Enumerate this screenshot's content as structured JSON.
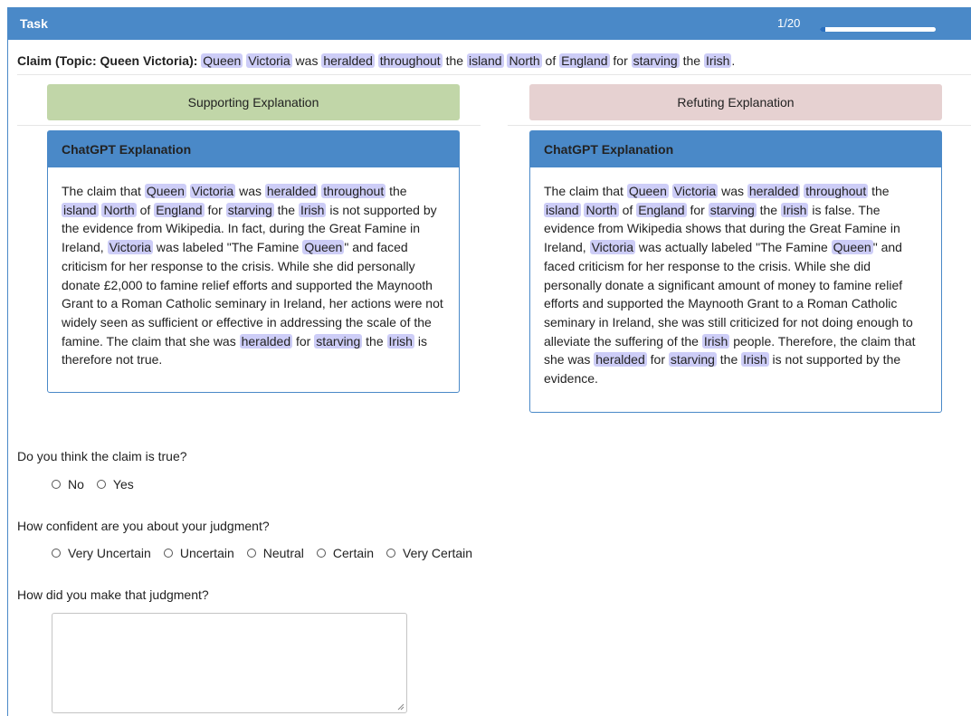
{
  "header": {
    "title": "Task",
    "progress_text": "1/20",
    "progress_fraction": 0.05,
    "color": "#4a89c8"
  },
  "claim": {
    "label": "Claim (Topic: Queen Victoria):",
    "segments": [
      {
        "t": "Queen",
        "hl": true
      },
      {
        "t": " "
      },
      {
        "t": "Victoria",
        "hl": true
      },
      {
        "t": " was "
      },
      {
        "t": "heralded",
        "hl": true
      },
      {
        "t": " "
      },
      {
        "t": "throughout",
        "hl": true
      },
      {
        "t": " the "
      },
      {
        "t": "island",
        "hl": true
      },
      {
        "t": " "
      },
      {
        "t": "North",
        "hl": true
      },
      {
        "t": " of "
      },
      {
        "t": "England",
        "hl": true
      },
      {
        "t": " for "
      },
      {
        "t": "starving",
        "hl": true
      },
      {
        "t": " the "
      },
      {
        "t": "Irish",
        "hl": true
      },
      {
        "t": "."
      }
    ]
  },
  "panes": {
    "supporting_label": "Supporting Explanation",
    "refuting_label": "Refuting Explanation",
    "supporting_color": "#c1d6a8",
    "refuting_color": "#e6d1d1"
  },
  "cards": {
    "left": {
      "title": "ChatGPT Explanation",
      "segments": [
        {
          "t": "The claim that "
        },
        {
          "t": "Queen",
          "hl": true
        },
        {
          "t": " "
        },
        {
          "t": "Victoria",
          "hl": true
        },
        {
          "t": " was "
        },
        {
          "t": "heralded",
          "hl": true
        },
        {
          "t": " "
        },
        {
          "t": "throughout",
          "hl": true
        },
        {
          "t": " the "
        },
        {
          "t": "island",
          "hl": true
        },
        {
          "t": " "
        },
        {
          "t": "North",
          "hl": true
        },
        {
          "t": " of "
        },
        {
          "t": "England",
          "hl": true
        },
        {
          "t": " for "
        },
        {
          "t": "starving",
          "hl": true
        },
        {
          "t": " the "
        },
        {
          "t": "Irish",
          "hl": true
        },
        {
          "t": " is not supported by the evidence from Wikipedia. In fact, during the Great Famine in Ireland, "
        },
        {
          "t": "Victoria",
          "hl": true
        },
        {
          "t": " was labeled \"The Famine "
        },
        {
          "t": "Queen",
          "hl": true
        },
        {
          "t": "\" and faced criticism for her response to the crisis. While she did personally donate £2,000 to famine relief efforts and supported the Maynooth Grant to a Roman Catholic seminary in Ireland, her actions were not widely seen as sufficient or effective in addressing the scale of the famine. The claim that she was "
        },
        {
          "t": "heralded",
          "hl": true
        },
        {
          "t": " for "
        },
        {
          "t": "starving",
          "hl": true
        },
        {
          "t": " the "
        },
        {
          "t": "Irish",
          "hl": true
        },
        {
          "t": " is therefore not true."
        }
      ]
    },
    "right": {
      "title": "ChatGPT Explanation",
      "segments": [
        {
          "t": "The claim that "
        },
        {
          "t": "Queen",
          "hl": true
        },
        {
          "t": " "
        },
        {
          "t": "Victoria",
          "hl": true
        },
        {
          "t": " was "
        },
        {
          "t": "heralded",
          "hl": true
        },
        {
          "t": " "
        },
        {
          "t": "throughout",
          "hl": true
        },
        {
          "t": " the "
        },
        {
          "t": "island",
          "hl": true
        },
        {
          "t": " "
        },
        {
          "t": "North",
          "hl": true
        },
        {
          "t": " of "
        },
        {
          "t": "England",
          "hl": true
        },
        {
          "t": " for "
        },
        {
          "t": "starving",
          "hl": true
        },
        {
          "t": " the "
        },
        {
          "t": "Irish",
          "hl": true
        },
        {
          "t": " is false. The evidence from Wikipedia shows that during the Great Famine in Ireland, "
        },
        {
          "t": "Victoria",
          "hl": true
        },
        {
          "t": " was actually labeled \"The Famine "
        },
        {
          "t": "Queen",
          "hl": true
        },
        {
          "t": "\" and faced criticism for her response to the crisis. While she did personally donate a significant amount of money to famine relief efforts and supported the Maynooth Grant to a Roman Catholic seminary in Ireland, she was still criticized for not doing enough to alleviate the suffering of the "
        },
        {
          "t": "Irish",
          "hl": true
        },
        {
          "t": " people. Therefore, the claim that she was "
        },
        {
          "t": "heralded",
          "hl": true
        },
        {
          "t": " for "
        },
        {
          "t": "starving",
          "hl": true
        },
        {
          "t": " the "
        },
        {
          "t": "Irish",
          "hl": true
        },
        {
          "t": " is not supported by the evidence."
        }
      ]
    }
  },
  "questions": {
    "truth": {
      "prompt": "Do you think the claim is true?",
      "options": [
        "No",
        "Yes"
      ]
    },
    "confidence": {
      "prompt": "How confident are you about your judgment?",
      "options": [
        "Very Uncertain",
        "Uncertain",
        "Neutral",
        "Certain",
        "Very Certain"
      ]
    },
    "method": {
      "prompt": "How did you make that judgment?",
      "value": ""
    }
  }
}
